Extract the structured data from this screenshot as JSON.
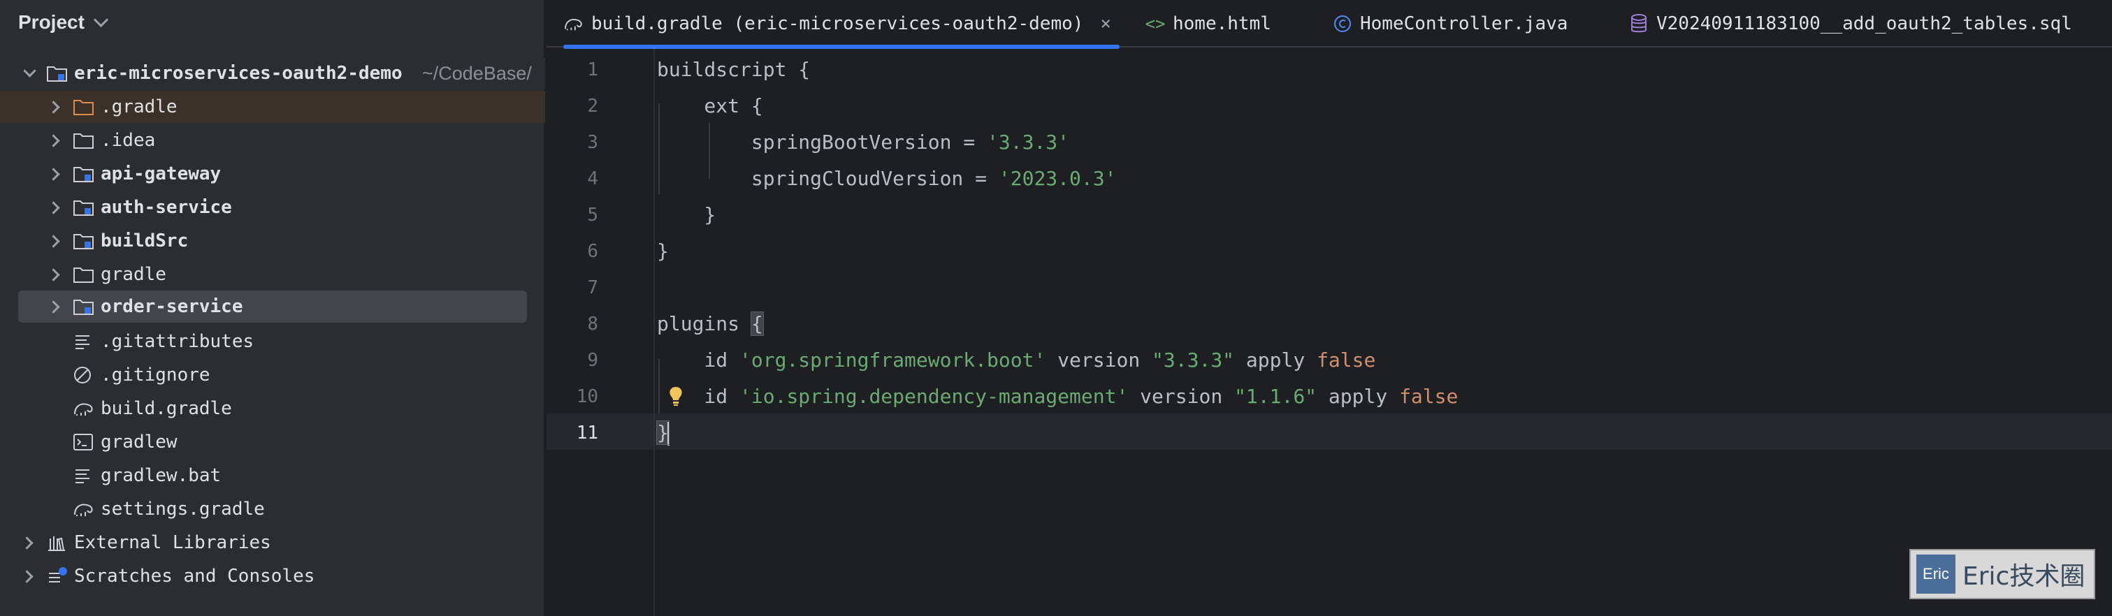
{
  "project_panel": {
    "title": "Project",
    "tree": [
      {
        "label": "eric-microservices-oauth2-demo",
        "suffix": "~/CodeBase/",
        "icon": "module-folder-icon"
      },
      {
        "label": ".gradle",
        "icon": "folder-icon"
      },
      {
        "label": ".idea",
        "icon": "folder-icon"
      },
      {
        "label": "api-gateway",
        "icon": "module-folder-icon"
      },
      {
        "label": "auth-service",
        "icon": "module-folder-icon"
      },
      {
        "label": "buildSrc",
        "icon": "module-folder-icon"
      },
      {
        "label": "gradle",
        "icon": "folder-icon"
      },
      {
        "label": "order-service",
        "icon": "module-folder-icon"
      },
      {
        "label": ".gitattributes",
        "icon": "text-file-icon"
      },
      {
        "label": ".gitignore",
        "icon": "ignore-file-icon"
      },
      {
        "label": "build.gradle",
        "icon": "gradle-elephant-icon"
      },
      {
        "label": "gradlew",
        "icon": "terminal-file-icon"
      },
      {
        "label": "gradlew.bat",
        "icon": "text-file-icon"
      },
      {
        "label": "settings.gradle",
        "icon": "gradle-elephant-icon"
      },
      {
        "label": "External Libraries",
        "icon": "library-icon"
      },
      {
        "label": "Scratches and Consoles",
        "icon": "scratches-icon"
      }
    ]
  },
  "tabs": [
    {
      "label": "build.gradle (eric-microservices-oauth2-demo)",
      "icon": "gradle-elephant-icon",
      "active": true,
      "close": "×"
    },
    {
      "label": "home.html",
      "icon": "html-icon"
    },
    {
      "label": "HomeController.java",
      "icon": "java-class-icon"
    },
    {
      "label": "V20240911183100__add_oauth2_tables.sql",
      "icon": "database-icon"
    }
  ],
  "editor": {
    "line_numbers": [
      "1",
      "2",
      "3",
      "4",
      "5",
      "6",
      "7",
      "8",
      "9",
      "10",
      "11"
    ],
    "current_line": "11",
    "lines": {
      "l1": {
        "a": "buildscript {"
      },
      "l2": {
        "a": "    ext {"
      },
      "l3": {
        "a": "        springBootVersion = ",
        "b": "'3.3.3'"
      },
      "l4": {
        "a": "        springCloudVersion = ",
        "b": "'2023.0.3'"
      },
      "l5": {
        "a": "    }"
      },
      "l6": {
        "a": "}"
      },
      "l8": {
        "a": "plugins ",
        "b": "{"
      },
      "l9": {
        "a": "    id ",
        "b": "'org.springframework.boot'",
        "c": " version ",
        "d": "\"3.3.3\"",
        "e": " apply ",
        "f": "false"
      },
      "l10": {
        "a": "    id ",
        "b": "'io.spring.dependency-management'",
        "c": " version ",
        "d": "\"1.1.6\"",
        "e": " apply ",
        "f": "false"
      },
      "l11": {
        "a": "}"
      }
    }
  },
  "colors": {
    "string": "#6aab73",
    "keyword": "#cf8e6d",
    "accent": "#3574f0",
    "background": "#1e1f22"
  },
  "watermark": {
    "logo": "Eric",
    "text": "Eric技术圈"
  }
}
